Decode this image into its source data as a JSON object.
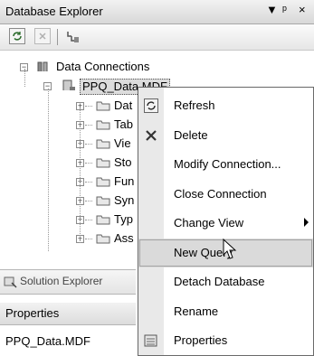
{
  "panel": {
    "title": "Database Explorer",
    "pin_glyph": "▾",
    "dock_glyph": "ᵖ",
    "close_glyph": "×"
  },
  "toolbar": {
    "buttons": [
      "refresh-icon",
      "stop-icon",
      "connect-icon"
    ]
  },
  "tree": {
    "root": "Data Connections",
    "connection": "PPQ_Data.MDF",
    "folders": [
      "Dat",
      "Tab",
      "Vie",
      "Sto",
      "Fun",
      "Syn",
      "Typ",
      "Ass"
    ]
  },
  "solution_tab": {
    "label": "Solution Explorer"
  },
  "properties": {
    "header": "Properties",
    "value": "PPQ_Data.MDF"
  },
  "context_menu": {
    "items": [
      {
        "label": "Refresh",
        "icon": "refresh-icon"
      },
      {
        "label": "Delete",
        "icon": "delete-icon"
      },
      {
        "label": "Modify Connection...",
        "icon": ""
      },
      {
        "label": "Close Connection",
        "icon": ""
      },
      {
        "label": "Change View",
        "icon": "",
        "submenu": true
      },
      {
        "label": "New Query",
        "icon": "",
        "hover": true
      },
      {
        "label": "Detach Database",
        "icon": ""
      },
      {
        "label": "Rename",
        "icon": ""
      },
      {
        "label": "Properties",
        "icon": "properties-icon"
      }
    ]
  }
}
